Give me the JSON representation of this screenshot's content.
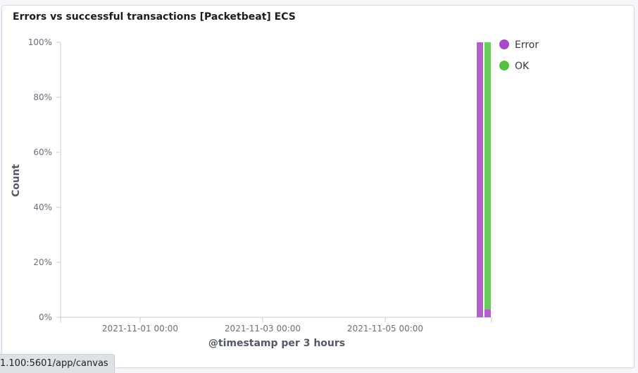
{
  "panel": {
    "title": "Errors vs successful transactions [Packetbeat] ECS"
  },
  "status_bar": {
    "url": "1.100:5601/app/canvas"
  },
  "chart_data": {
    "type": "bar",
    "stacked": true,
    "percentage_mode": true,
    "xlabel": "@timestamp per 3 hours",
    "ylabel": "Count",
    "ylim": [
      0,
      100
    ],
    "y_ticks": [
      "0%",
      "20%",
      "40%",
      "60%",
      "80%",
      "100%"
    ],
    "x_ticks": [
      "2021-11-01 00:00",
      "2021-11-03 00:00",
      "2021-11-05 00:00"
    ],
    "legend_position": "top-right",
    "colors": {
      "Error": "#a64ac9",
      "OK": "#54b399"
    },
    "series": [
      {
        "name": "Error",
        "color": "#b160cc",
        "values": [
          100,
          3
        ]
      },
      {
        "name": "OK",
        "color": "#6ac95f",
        "values": [
          0,
          97
        ]
      }
    ],
    "categories": [
      "2021-11-06 12:00",
      "2021-11-06 15:00"
    ]
  }
}
